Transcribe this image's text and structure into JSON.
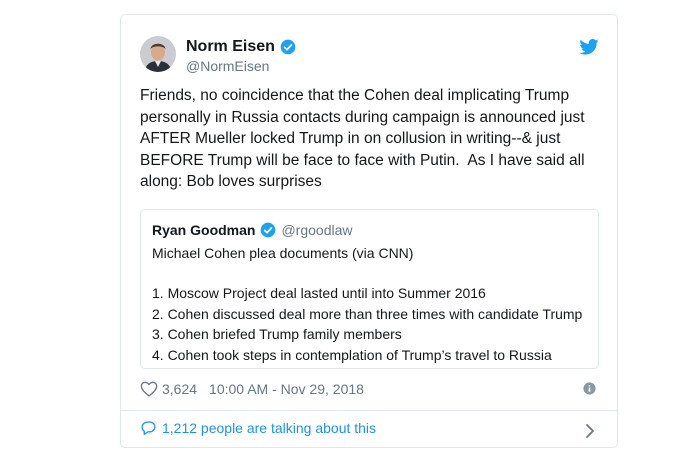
{
  "tweet": {
    "author_name": "Norm Eisen",
    "author_handle": "@NormEisen",
    "text": "Friends, no coincidence that the Cohen deal implicating Trump personally in Russia contacts during campaign is announced just AFTER Mueller locked Trump in on collusion in writing--& just BEFORE Trump will be face to face with Putin.  As I have said all along: Bob loves surprises",
    "likes": "3,624",
    "timestamp": "10:00 AM - Nov 29, 2018",
    "talking": "1,212 people are talking about this"
  },
  "quoted": {
    "author_name": "Ryan Goodman",
    "author_handle": "@rgoodlaw",
    "intro": "Michael Cohen plea documents (via CNN)",
    "items": [
      "1. Moscow Project deal lasted until into Summer 2016",
      "2. Cohen discussed deal more than three times with candidate Trump",
      "3. Cohen briefed Trump family members",
      "4. Cohen took steps in contemplation of Trump’s travel to Russia"
    ]
  },
  "colors": {
    "twitter_blue": "#1da1f2",
    "link_blue": "#1b95e0",
    "secondary_text": "#657786",
    "border": "#e1e8ed"
  },
  "icons": [
    "verified-badge-icon",
    "twitter-bird-icon",
    "heart-icon",
    "info-icon",
    "speech-bubble-icon",
    "chevron-right-icon"
  ]
}
